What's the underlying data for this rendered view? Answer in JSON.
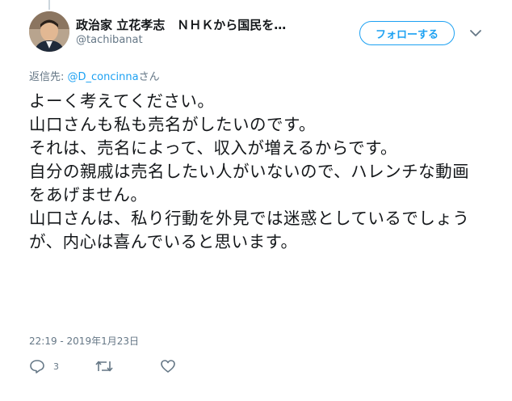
{
  "author": {
    "display_name": "政治家 立花孝志　ＮＨＫから国民を…",
    "handle": "@tachibanat"
  },
  "follow_button": {
    "label": "フォローする"
  },
  "reply_context": {
    "prefix": "返信先: ",
    "mention": "@D_concinna",
    "suffix": "さん"
  },
  "tweet": {
    "text": "よーく考えてください。\n山口さんも私も売名がしたいのです。\nそれは、売名によって、収入が増えるからです。\n自分の親戚は売名したい人がいないので、ハレンチな動画をあげません。\n山口さんは、私り行動を外見では迷惑としているでしょうが、内心は喜んでいると思います。",
    "timestamp": "22:19 - 2019年1月23日"
  },
  "actions": {
    "reply_count": "3",
    "reply_icon": "speech-bubble-icon",
    "retweet_icon": "retweet-icon",
    "like_icon": "heart-icon"
  },
  "colors": {
    "accent": "#1da1f2",
    "muted": "#657786",
    "text": "#14171a"
  }
}
